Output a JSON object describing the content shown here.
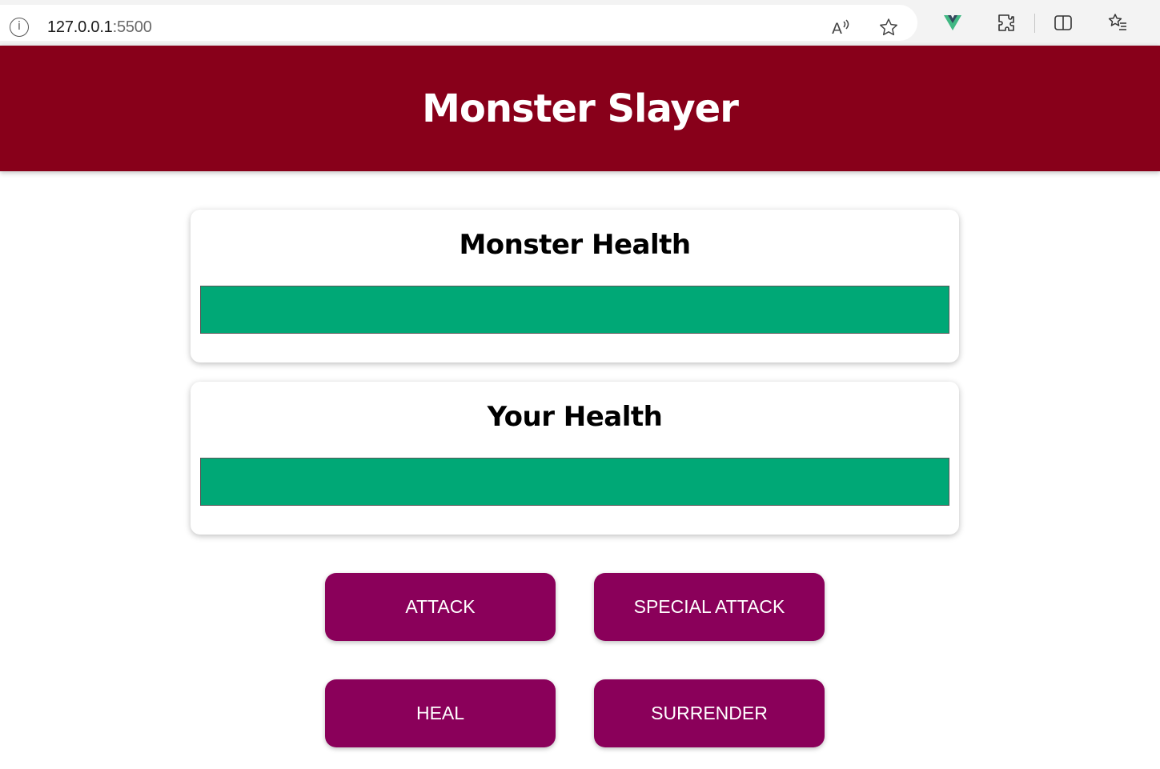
{
  "browser": {
    "url_host": "127.0.0.1",
    "url_port": ":5500",
    "icons": [
      "info-icon",
      "read-aloud-icon",
      "favorite-star-icon",
      "vue-devtools-icon",
      "extensions-icon",
      "split-screen-icon",
      "favorites-list-icon"
    ]
  },
  "app": {
    "title": "Monster Slayer",
    "monster": {
      "label": "Monster Health",
      "health_percent": 100
    },
    "player": {
      "label": "Your Health",
      "health_percent": 100
    },
    "controls": {
      "attack": "ATTACK",
      "special_attack": "SPECIAL ATTACK",
      "heal": "HEAL",
      "surrender": "SURRENDER"
    },
    "colors": {
      "header": "#88001a",
      "health_fill": "#00a876",
      "button": "#8a005a"
    }
  }
}
